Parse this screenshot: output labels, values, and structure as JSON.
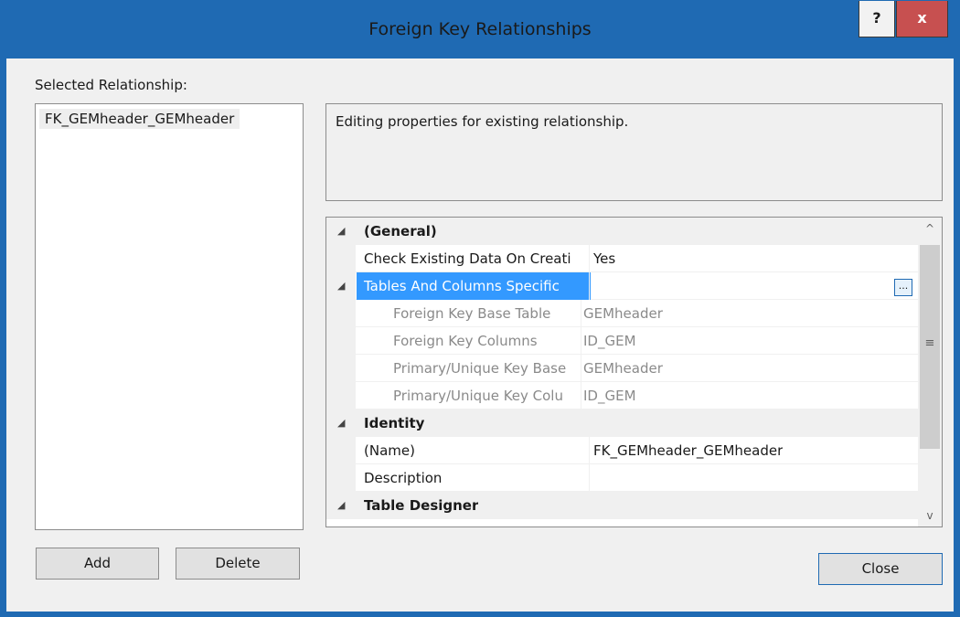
{
  "window": {
    "title": "Foreign Key Relationships",
    "help_label": "?",
    "close_label": "x"
  },
  "selected_relationship": {
    "label": "Selected Relationship:",
    "items": [
      "FK_GEMheader_GEMheader"
    ]
  },
  "buttons": {
    "add": "Add",
    "delete": "Delete",
    "close": "Close"
  },
  "description": "Editing properties for existing relationship.",
  "properties": {
    "expander_glyph": "◢",
    "ellipsis_label": "...",
    "rows": [
      {
        "type": "category",
        "name": "(General)"
      },
      {
        "type": "property",
        "name": "Check Existing Data On Creati",
        "value": "Yes"
      },
      {
        "type": "selected",
        "name": "Tables And Columns Specific",
        "value": ""
      },
      {
        "type": "sub",
        "name": "Foreign Key Base Table",
        "value": "GEMheader"
      },
      {
        "type": "sub",
        "name": "Foreign Key Columns",
        "value": "ID_GEM"
      },
      {
        "type": "sub",
        "name": "Primary/Unique Key Base",
        "value": "GEMheader"
      },
      {
        "type": "sub",
        "name": "Primary/Unique Key Colu",
        "value": "ID_GEM"
      },
      {
        "type": "category",
        "name": "Identity"
      },
      {
        "type": "property",
        "name": "(Name)",
        "value": "FK_GEMheader_GEMheader"
      },
      {
        "type": "property",
        "name": "Description",
        "value": ""
      },
      {
        "type": "category",
        "name": "Table Designer"
      }
    ]
  },
  "scrollbar": {
    "up_icon": "^",
    "down_icon": "v",
    "grip_icon": "≡"
  },
  "colors": {
    "titlebar": "#1f6ab3",
    "close_button": "#c75050",
    "selection": "#3399ff"
  }
}
